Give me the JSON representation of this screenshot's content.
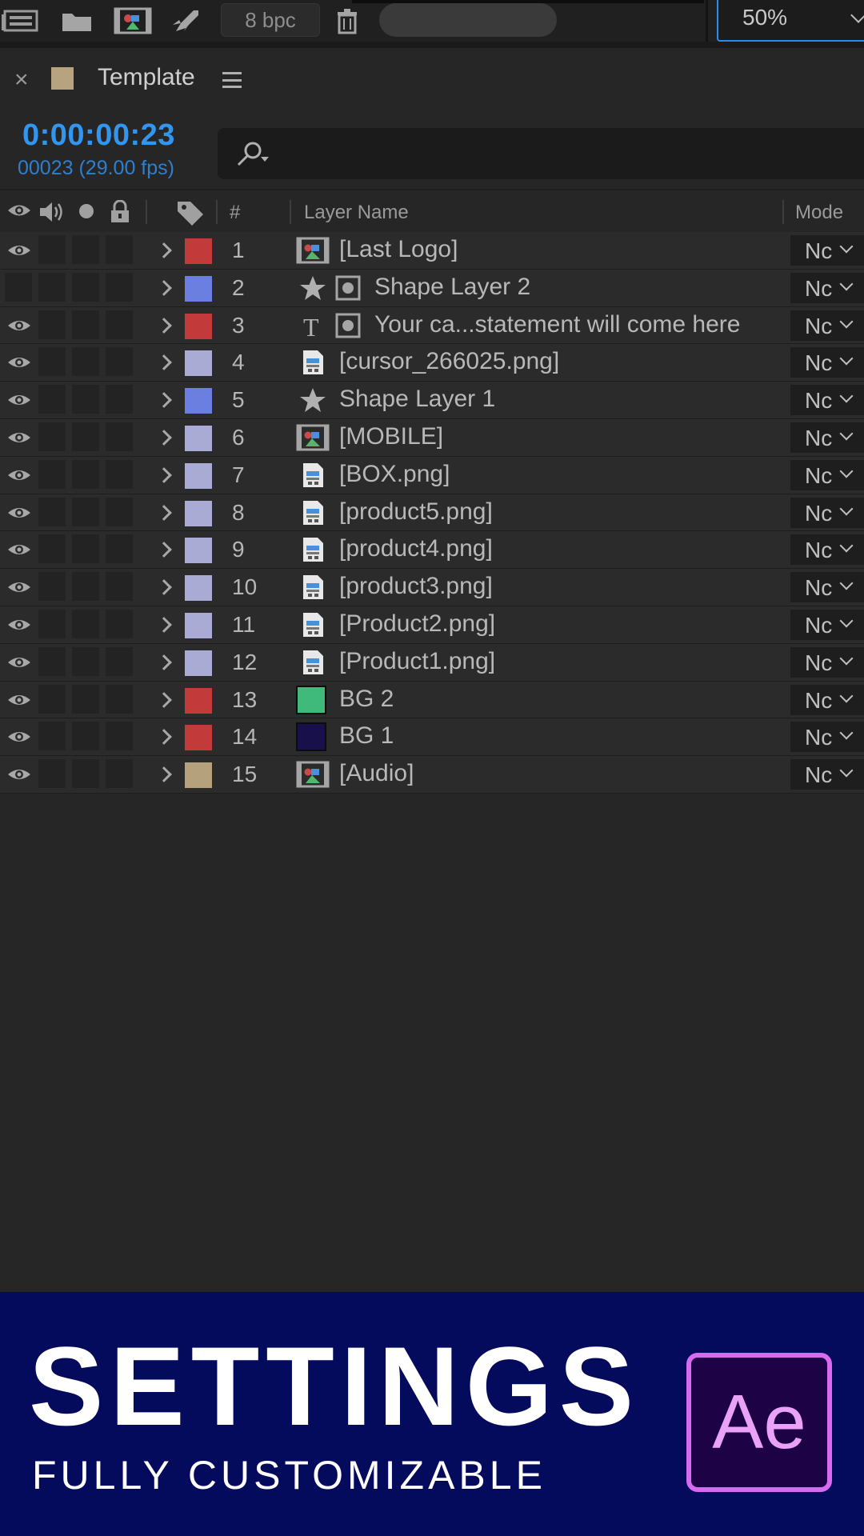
{
  "toolbar": {
    "bpc_label": "8 bpc",
    "zoom_value": "50%"
  },
  "panel": {
    "close_glyph": "×",
    "title": "Template",
    "comp_color": "#b7a37f"
  },
  "time": {
    "timecode": "0:00:00:23",
    "frame_fps": "00023 (29.00 fps)"
  },
  "columns": {
    "number": "#",
    "layer_name": "Layer Name",
    "mode": "Mode"
  },
  "layers": [
    {
      "num": "1",
      "name": "[Last Logo]",
      "label_color": "#c23a3a",
      "icon": "footage-comp-icon",
      "visible": true,
      "extra_icon": false
    },
    {
      "num": "2",
      "name": "Shape Layer 2",
      "label_color": "#6a7fe0",
      "icon": "shape-star-icon",
      "visible": false,
      "extra_icon": true
    },
    {
      "num": "3",
      "name": "Your ca...statement will come here",
      "label_color": "#c23a3a",
      "icon": "text-layer-icon",
      "visible": true,
      "extra_icon": true
    },
    {
      "num": "4",
      "name": "[cursor_266025.png]",
      "label_color": "#a9abd4",
      "icon": "image-file-icon",
      "visible": true,
      "extra_icon": false
    },
    {
      "num": "5",
      "name": "Shape Layer 1",
      "label_color": "#6a7fe0",
      "icon": "shape-star-icon",
      "visible": true,
      "extra_icon": false
    },
    {
      "num": "6",
      "name": "[MOBILE]",
      "label_color": "#a9abd4",
      "icon": "footage-comp-icon",
      "visible": true,
      "extra_icon": false
    },
    {
      "num": "7",
      "name": "[BOX.png]",
      "label_color": "#a9abd4",
      "icon": "image-file-icon",
      "visible": true,
      "extra_icon": false
    },
    {
      "num": "8",
      "name": "[product5.png]",
      "label_color": "#a9abd4",
      "icon": "image-file-icon",
      "visible": true,
      "extra_icon": false
    },
    {
      "num": "9",
      "name": "[product4.png]",
      "label_color": "#a9abd4",
      "icon": "image-file-icon",
      "visible": true,
      "extra_icon": false
    },
    {
      "num": "10",
      "name": "[product3.png]",
      "label_color": "#a9abd4",
      "icon": "image-file-icon",
      "visible": true,
      "extra_icon": false
    },
    {
      "num": "11",
      "name": "[Product2.png]",
      "label_color": "#a9abd4",
      "icon": "image-file-icon",
      "visible": true,
      "extra_icon": false
    },
    {
      "num": "12",
      "name": "[Product1.png]",
      "label_color": "#a9abd4",
      "icon": "image-file-icon",
      "visible": true,
      "extra_icon": false
    },
    {
      "num": "13",
      "name": "BG 2",
      "label_color": "#c23a3a",
      "icon": "solid-color-icon",
      "solid_color": "#3fba7a",
      "visible": true,
      "extra_icon": false
    },
    {
      "num": "14",
      "name": "BG 1",
      "label_color": "#c23a3a",
      "icon": "solid-color-icon",
      "solid_color": "#17104a",
      "visible": true,
      "extra_icon": false
    },
    {
      "num": "15",
      "name": "[Audio]",
      "label_color": "#b5a17c",
      "icon": "footage-comp-icon",
      "visible": true,
      "extra_icon": false
    }
  ],
  "mode_value": "Nc",
  "banner": {
    "title": "SETTINGS",
    "subtitle": "FULLY CUSTOMIZABLE",
    "logo_text": "Ae"
  }
}
